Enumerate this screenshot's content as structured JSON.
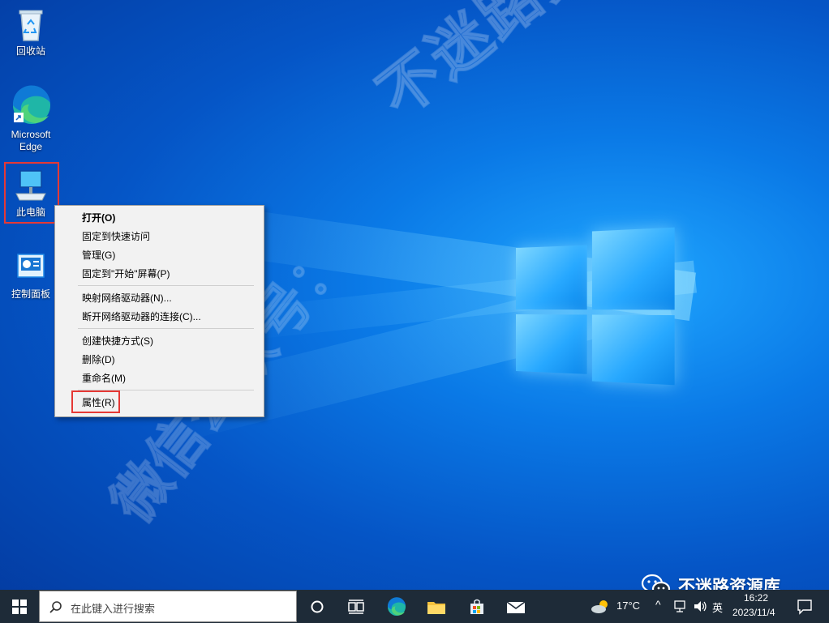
{
  "desktop": {
    "icons": [
      {
        "label": "回收站"
      },
      {
        "label": "Microsoft Edge"
      },
      {
        "label": "此电脑"
      },
      {
        "label": "控制面板"
      }
    ],
    "watermark": "不迷路资源库",
    "watermark_secondary": "微信公众号："
  },
  "context_menu": {
    "items": [
      {
        "label": "打开(O)"
      },
      {
        "label": "固定到快速访问"
      },
      {
        "label": "管理(G)"
      },
      {
        "label": "固定到\"开始\"屏幕(P)"
      },
      {
        "label": "映射网络驱动器(N)..."
      },
      {
        "label": "断开网络驱动器的连接(C)..."
      },
      {
        "label": "创建快捷方式(S)"
      },
      {
        "label": "删除(D)"
      },
      {
        "label": "重命名(M)"
      },
      {
        "label": "属性(R)"
      }
    ]
  },
  "taskbar": {
    "search_placeholder": "在此键入进行搜索",
    "weather": "17°C",
    "ime": "英",
    "time": "16:22",
    "date": "2023/11/4"
  },
  "wechat_badge": "不迷路资源库",
  "colors": {
    "accent": "#0a79e6",
    "highlight": "#e53935",
    "taskbar": "#1e2b38"
  }
}
